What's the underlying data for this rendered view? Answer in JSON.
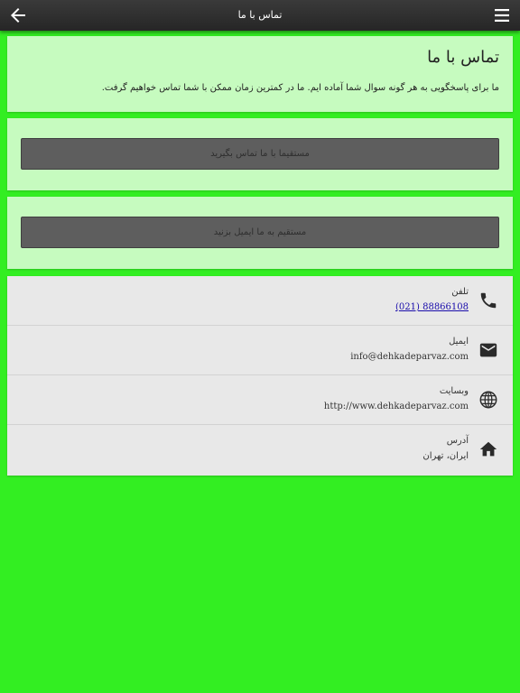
{
  "header": {
    "title": "تماس با ما",
    "back_icon": "arrow-left-icon",
    "menu_icon": "hamburger-menu-icon"
  },
  "intro": {
    "title": "تماس با ما",
    "text": "ما برای پاسخگویی به هر گونه سوال شما آماده ایم. ما در کمترین زمان ممکن با شما تماس خواهیم گرفت."
  },
  "actions": {
    "call_label": "مستقیما با ما تماس بگیرید",
    "email_label": "مستقیم به ما ایمیل بزنید"
  },
  "info": {
    "items": [
      {
        "icon": "phone-icon",
        "label": "تلفن",
        "value": "(021) 88866108"
      },
      {
        "icon": "mail-icon",
        "label": "ایمیل",
        "value": "info@dehkadeparvaz.com"
      },
      {
        "icon": "globe-icon",
        "label": "وبسایت",
        "value": "http://www.dehkadeparvaz.com"
      },
      {
        "icon": "home-icon",
        "label": "آدرس",
        "value": "ایران، تهران"
      }
    ]
  },
  "colors": {
    "background": "#33ee22",
    "card": "#c6fbbf",
    "topbar": "#2e2e2e",
    "button": "#5e5e5e",
    "info_list": "#e8e8e8",
    "link": "#1a0dab"
  }
}
